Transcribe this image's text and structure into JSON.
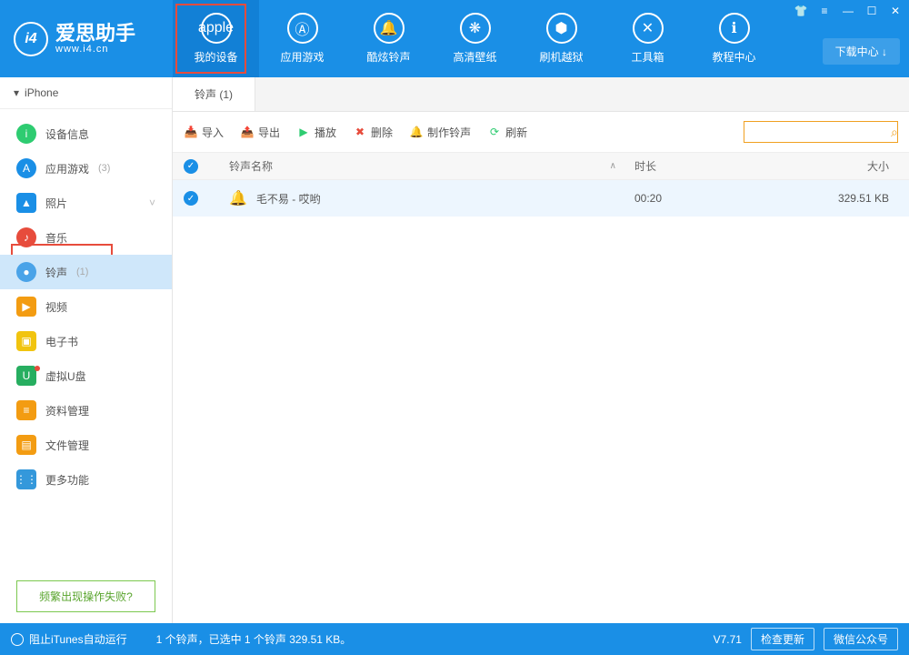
{
  "brand": {
    "name": "爱思助手",
    "url": "www.i4.cn",
    "logo_text": "i4"
  },
  "download_center": "下载中心 ↓",
  "top_nav": [
    {
      "label": "我的设备",
      "icon": "apple"
    },
    {
      "label": "应用游戏",
      "icon": "A"
    },
    {
      "label": "酷炫铃声",
      "icon": "bell"
    },
    {
      "label": "高清壁纸",
      "icon": "flower"
    },
    {
      "label": "刷机越狱",
      "icon": "box"
    },
    {
      "label": "工具箱",
      "icon": "wrench"
    },
    {
      "label": "教程中心",
      "icon": "i"
    }
  ],
  "device_header": "iPhone",
  "sidebar": [
    {
      "label": "设备信息",
      "count": "",
      "color": "#2ecc71",
      "glyph": "i"
    },
    {
      "label": "应用游戏",
      "count": "(3)",
      "color": "#1a8fe6",
      "glyph": "A"
    },
    {
      "label": "照片",
      "count": "",
      "color": "#1a8fe6",
      "glyph": "▲",
      "shape": "sq",
      "chevron": true
    },
    {
      "label": "音乐",
      "count": "",
      "color": "#e74c3c",
      "glyph": "♪"
    },
    {
      "label": "铃声",
      "count": "(1)",
      "color": "#4aa3e8",
      "glyph": "●",
      "active": true
    },
    {
      "label": "视频",
      "count": "",
      "color": "#f39c12",
      "glyph": "▶",
      "shape": "sq"
    },
    {
      "label": "电子书",
      "count": "",
      "color": "#f1c40f",
      "glyph": "▣",
      "shape": "sq"
    },
    {
      "label": "虚拟U盘",
      "count": "",
      "color": "#27ae60",
      "glyph": "U",
      "shape": "sq",
      "dot": true
    },
    {
      "label": "资料管理",
      "count": "",
      "color": "#f39c12",
      "glyph": "≡",
      "shape": "sq"
    },
    {
      "label": "文件管理",
      "count": "",
      "color": "#f39c12",
      "glyph": "▤",
      "shape": "sq"
    },
    {
      "label": "更多功能",
      "count": "",
      "color": "#3498db",
      "glyph": "⋮⋮",
      "shape": "sq"
    }
  ],
  "faq": "频繁出现操作失败?",
  "tab": "铃声 (1)",
  "toolbar": {
    "import": "导入",
    "export": "导出",
    "play": "播放",
    "delete": "删除",
    "make": "制作铃声",
    "refresh": "刷新"
  },
  "columns": {
    "name": "铃声名称",
    "duration": "时长",
    "size": "大小"
  },
  "rows": [
    {
      "name": "毛不易 - 哎哟",
      "duration": "00:20",
      "size": "329.51 KB"
    }
  ],
  "footer": {
    "itunes": "阻止iTunes自动运行",
    "status": "1 个铃声，已选中 1 个铃声 329.51 KB。",
    "version": "V7.71",
    "check_update": "检查更新",
    "wechat": "微信公众号"
  }
}
